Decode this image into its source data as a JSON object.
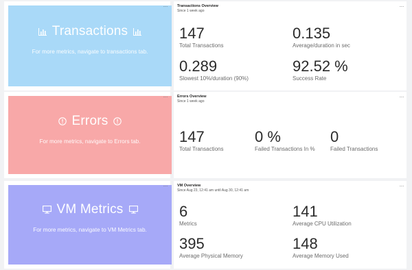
{
  "transactions": {
    "banner": {
      "title": "Transactions",
      "subtitle": "For more metrics, navigate to transactions tab.",
      "color": "#a9d9f8",
      "icon": "bar-chart-icon"
    },
    "panel": {
      "title": "Transactions Overview",
      "subtitle": "Since 1 week ago",
      "metrics": [
        {
          "value": "147",
          "label": "Total Transactions"
        },
        {
          "value": "0.135",
          "label": "Average/duration in sec"
        },
        {
          "value": "0.289",
          "label": "Slowest 10%/duration (90%)"
        },
        {
          "value": "92.52 %",
          "label": "Success Rate"
        }
      ]
    }
  },
  "errors": {
    "banner": {
      "title": "Errors",
      "subtitle": "For more metrics, navigate to Errors tab.",
      "color": "#f8a8a8",
      "icon": "info-circle-icon"
    },
    "panel": {
      "title": "Errors Overview",
      "subtitle": "Since 1 week ago",
      "metrics": [
        {
          "value": "147",
          "label": "Total Transactions"
        },
        {
          "value": "0 %",
          "label": "Failed Transactions In %"
        },
        {
          "value": "0",
          "label": "Failed Transactions"
        }
      ]
    }
  },
  "vm": {
    "banner": {
      "title": "VM Metrics",
      "subtitle": "For more metrics, navigate to VM Metrics tab.",
      "color": "#a6a9f8",
      "icon": "monitor-icon"
    },
    "panel": {
      "title": "VM Overview",
      "subtitle": "Since Aug 23, 12:41 am until Aug 30, 12:41 am",
      "metrics": [
        {
          "value": "6",
          "label": "Metrics"
        },
        {
          "value": "141",
          "label": "Average CPU Utilization"
        },
        {
          "value": "395",
          "label": "Average Physical Memory"
        },
        {
          "value": "148",
          "label": "Average Memory Used"
        }
      ]
    }
  },
  "menu_glyph": "···"
}
